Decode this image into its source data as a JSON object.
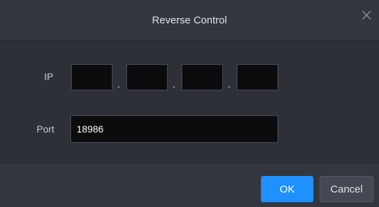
{
  "dialog": {
    "title": "Reverse Control",
    "close_icon": "close-icon"
  },
  "ip": {
    "label": "IP",
    "octets": [
      "",
      "",
      "",
      ""
    ],
    "separator": "."
  },
  "port": {
    "label": "Port",
    "value": "18986"
  },
  "footer": {
    "ok_label": "OK",
    "cancel_label": "Cancel"
  },
  "colors": {
    "accent": "#1e90ff",
    "background": "#2e3038",
    "header": "#34363f",
    "input_bg": "#0c0c0e"
  }
}
